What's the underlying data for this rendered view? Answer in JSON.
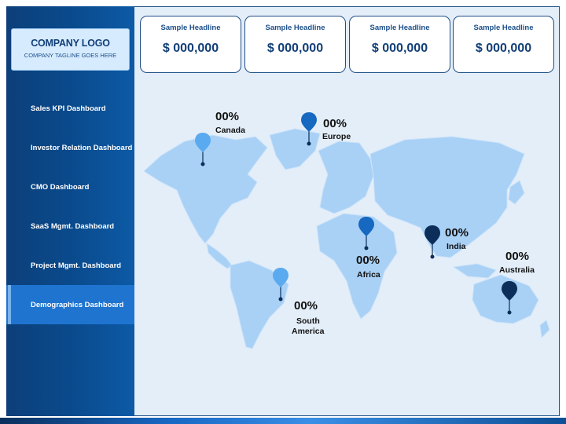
{
  "sidebar": {
    "logo_title": "COMPANY LOGO",
    "logo_tagline": "COMPANY TAGLINE GOES HERE",
    "items": [
      {
        "label": "Sales KPI Dashboard"
      },
      {
        "label": "Investor Relation Dashboard"
      },
      {
        "label": "CMO Dashboard"
      },
      {
        "label": "SaaS Mgmt. Dashboard"
      },
      {
        "label": "Project Mgmt. Dashboard"
      },
      {
        "label": "Demographics Dashboard",
        "active": true
      }
    ]
  },
  "kpis": [
    {
      "title": "Sample Headline",
      "value": "$ 000,000"
    },
    {
      "title": "Sample Headline",
      "value": "$ 000,000"
    },
    {
      "title": "Sample Headline",
      "value": "$ 000,000"
    },
    {
      "title": "Sample Headline",
      "value": "$ 000,000"
    }
  ],
  "regions": {
    "canada": {
      "pct": "00%",
      "name": "Canada"
    },
    "europe": {
      "pct": "00%",
      "name": "Europe"
    },
    "africa": {
      "pct": "00%",
      "name": "Africa"
    },
    "india": {
      "pct": "00%",
      "name": "India"
    },
    "australia": {
      "pct": "00%",
      "name": "Australia"
    },
    "south_america": {
      "pct": "00%",
      "name_line1": "South",
      "name_line2": "America"
    }
  },
  "colors": {
    "sidebar": "#0a4a8c",
    "active_item": "#1f74d0",
    "map_land": "#a9d0f5",
    "pin_light": "#5aaaf0",
    "pin_mid": "#1668c0",
    "pin_dark": "#0b2f5a"
  },
  "icons": {
    "map_pin": "map-pin-icon"
  }
}
